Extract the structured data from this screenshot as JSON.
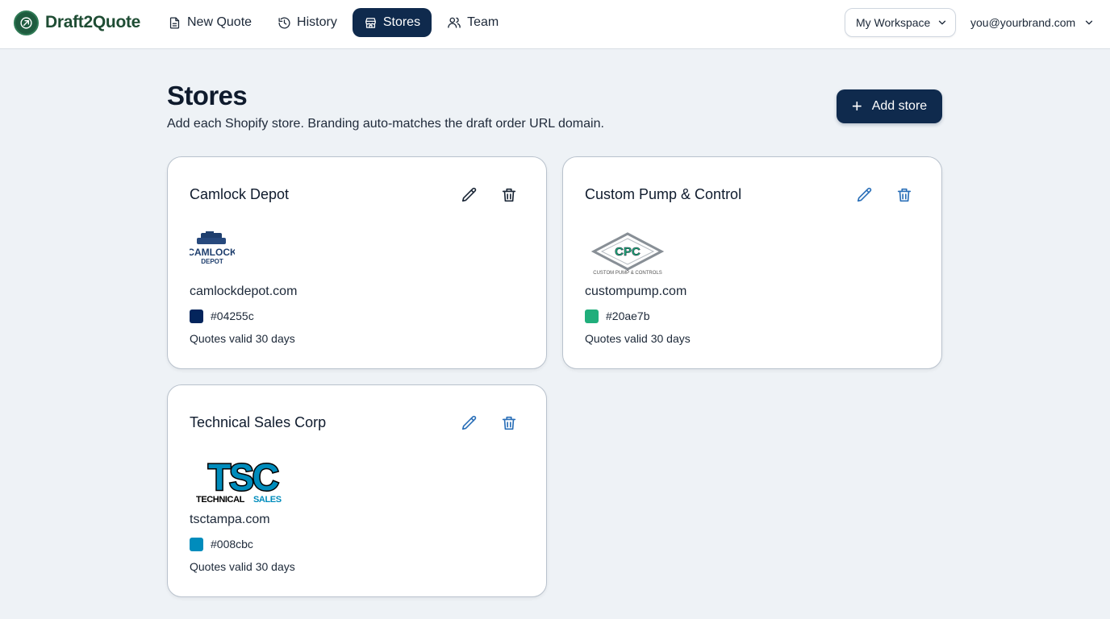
{
  "app": {
    "name": "Draft2Quote"
  },
  "nav": [
    {
      "label": "New Quote",
      "icon": "document-icon"
    },
    {
      "label": "History",
      "icon": "history-icon"
    },
    {
      "label": "Stores",
      "icon": "store-icon",
      "active": true
    },
    {
      "label": "Team",
      "icon": "users-icon"
    }
  ],
  "workspace": {
    "label": "My Workspace"
  },
  "user": {
    "email": "you@yourbrand.com"
  },
  "page": {
    "title": "Stores",
    "subtitle": "Add each Shopify store. Branding auto-matches the draft order URL domain.",
    "add_button": "Add store"
  },
  "stores": [
    {
      "name": "Camlock Depot",
      "domain": "camlockdepot.com",
      "color": "#04255c",
      "validity": "Quotes valid 30 days",
      "logo_text": [
        "CAMLOCK",
        "DEPOT"
      ],
      "icon_color": "#1c2838"
    },
    {
      "name": "Custom Pump & Control",
      "domain": "custompump.com",
      "color": "#20ae7b",
      "validity": "Quotes valid 30 days",
      "logo_text": [
        "CPC",
        "CUSTOM PUMP & CONTROLS"
      ],
      "icon_color": "#2a6fb8"
    },
    {
      "name": "Technical Sales Corp",
      "domain": "tsctampa.com",
      "color": "#008cbc",
      "validity": "Quotes valid 30 days",
      "logo_text": [
        "TSC",
        "TECHNICAL",
        "SALES"
      ],
      "icon_color": "#2a6fb8"
    }
  ]
}
